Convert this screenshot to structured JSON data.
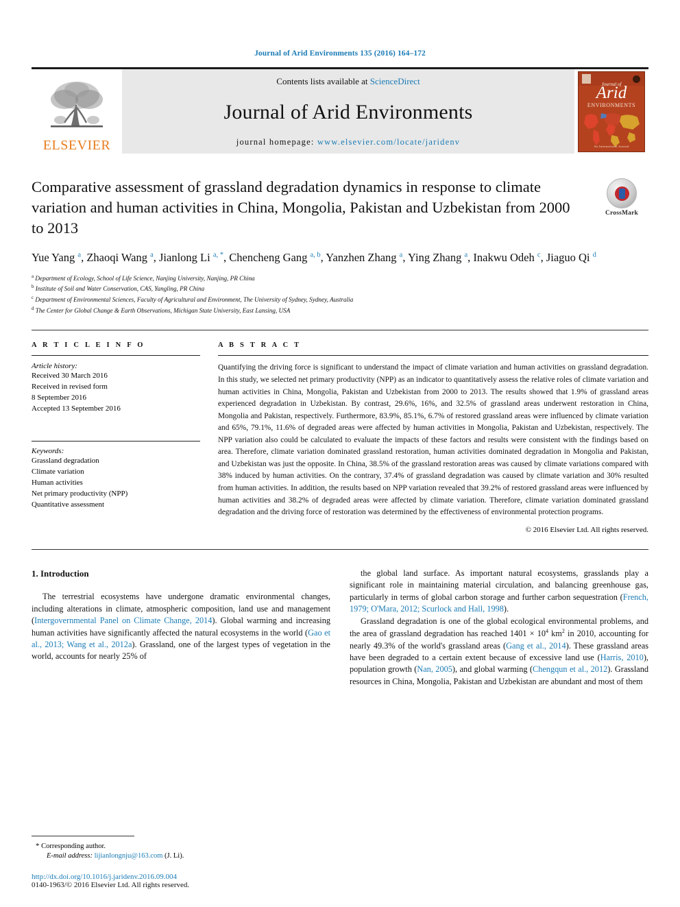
{
  "running_head": "Journal of Arid Environments 135 (2016) 164–172",
  "masthead": {
    "elsevier_wordmark": "ELSEVIER",
    "contents_prefix": "Contents lists available at ",
    "sciencedirect": "ScienceDirect",
    "journal_title": "Journal of Arid Environments",
    "homepage_prefix": "journal homepage: ",
    "homepage_url": "www.elsevier.com/locate/jaridenv",
    "cover": {
      "journal_of": "Journal of",
      "arid": "Arid",
      "environments": "ENVIRONMENTS",
      "footer": "An International Journal"
    },
    "colors": {
      "link_blue": "#1a7bb5",
      "elsevier_orange": "#e87d1e",
      "band_grey": "#e8e8e8",
      "cover_red": "#b5421f"
    }
  },
  "article": {
    "title": "Comparative assessment of grassland degradation dynamics in response to climate variation and human activities in China, Mongolia, Pakistan and Uzbekistan from 2000 to 2013",
    "crossmark_label": "CrossMark",
    "authors_line1": "Yue Yang",
    "authors_html": "Yue Yang <sup>a</sup>, Zhaoqi Wang <sup>a</sup>, Jianlong Li <sup>a, *</sup>, Chencheng Gang <sup>a, b</sup>, Yanzhen Zhang <sup>a</sup>, Ying Zhang <sup>a</sup>, Inakwu Odeh <sup>c</sup>, Jiaguo Qi <sup>d</sup>",
    "affiliations": [
      {
        "marker": "a",
        "text": "Department of Ecology, School of Life Science, Nanjing University, Nanjing, PR China"
      },
      {
        "marker": "b",
        "text": "Institute of Soil and Water Conservation, CAS, Yangling, PR China"
      },
      {
        "marker": "c",
        "text": "Department of Environmental Sciences, Faculty of Agricultural and Environment, The University of Sydney, Sydney, Australia"
      },
      {
        "marker": "d",
        "text": "The Center for Global Change & Earth Observations, Michigan State University, East Lansing, USA"
      }
    ]
  },
  "article_info": {
    "heading": "A R T I C L E   I N F O",
    "history_label": "Article history:",
    "history": [
      "Received 30 March 2016",
      "Received in revised form",
      "8 September 2016",
      "Accepted 13 September 2016"
    ],
    "keywords_label": "Keywords:",
    "keywords": [
      "Grassland degradation",
      "Climate variation",
      "Human activities",
      "Net primary productivity (NPP)",
      "Quantitative assessment"
    ]
  },
  "abstract": {
    "heading": "A B S T R A C T",
    "text": "Quantifying the driving force is significant to understand the impact of climate variation and human activities on grassland degradation. In this study, we selected net primary productivity (NPP) as an indicator to quantitatively assess the relative roles of climate variation and human activities in China, Mongolia, Pakistan and Uzbekistan from 2000 to 2013. The results showed that 1.9% of grassland areas experienced degradation in Uzbekistan. By contrast, 29.6%, 16%, and 32.5% of grassland areas underwent restoration in China, Mongolia and Pakistan, respectively. Furthermore, 83.9%, 85.1%, 6.7% of restored grassland areas were influenced by climate variation and 65%, 79.1%, 11.6% of degraded areas were affected by human activities in Mongolia, Pakistan and Uzbekistan, respectively. The NPP variation also could be calculated to evaluate the impacts of these factors and results were consistent with the findings based on area. Therefore, climate variation dominated grassland restoration, human activities dominated degradation in Mongolia and Pakistan, and Uzbekistan was just the opposite. In China, 38.5% of the grassland restoration areas was caused by climate variations compared with 38% induced by human activities. On the contrary, 37.4% of grassland degradation was caused by climate variation and 30% resulted from human activities. In addition, the results based on NPP variation revealed that 39.2% of restored grassland areas were influenced by human activities and 38.2% of degraded areas were affected by climate variation. Therefore, climate variation dominated grassland degradation and the driving force of restoration was determined by the effectiveness of environmental protection programs.",
    "copyright": "© 2016 Elsevier Ltd. All rights reserved."
  },
  "introduction": {
    "heading": "1. Introduction",
    "left_paragraph_1_pre": "The terrestrial ecosystems have undergone dramatic environmental changes, including alterations in climate, atmospheric composition, land use and management (",
    "cite_ipcc": "Intergovernmental Panel on Climate Change, 2014",
    "left_paragraph_1_mid": "). Global warming and increasing human activities have significantly affected the natural ecosystems in the world (",
    "cite_gao": "Gao et al., 2013; Wang et al., 2012a",
    "left_paragraph_1_post": "). Grassland, one of the largest types of vegetation in the world, accounts for nearly 25% of",
    "right_paragraph_1_pre": "the global land surface. As important natural ecosystems, grasslands play a significant role in maintaining material circulation, and balancing greenhouse gas, particularly in terms of global carbon storage and further carbon sequestration (",
    "cite_french": "French, 1979; O'Mara, 2012; Scurlock and Hall, 1998",
    "right_paragraph_1_post": ").",
    "right_paragraph_2_pre": "Grassland degradation is one of the global ecological environmental problems, and the area of grassland degradation has reached 1401 × 10",
    "exp_4": "4",
    "right_paragraph_2_km": " km",
    "exp_2": "2",
    "right_paragraph_2_mid": " in 2010, accounting for nearly 49.3% of the world's grassland areas (",
    "cite_gang": "Gang et al., 2014",
    "right_paragraph_2_mid2": "). These grassland areas have been degraded to a certain extent because of excessive land use (",
    "cite_harris": "Harris, 2010",
    "right_paragraph_2_mid3": "), population growth (",
    "cite_nan": "Nan, 2005",
    "right_paragraph_2_mid4": "), and global warming (",
    "cite_chengqun": "Chengqun et al., 2012",
    "right_paragraph_2_post": "). Grassland resources in China, Mongolia, Pakistan and Uzbekistan are abundant and most of them"
  },
  "footnote": {
    "corresponding": "Corresponding author.",
    "email_label": "E-mail address:",
    "email": "lijianlongnju@163.com",
    "email_suffix": "(J. Li).",
    "doi": "http://dx.doi.org/10.1016/j.jaridenv.2016.09.004",
    "issn": "0140-1963/© 2016 Elsevier Ltd. All rights reserved."
  }
}
